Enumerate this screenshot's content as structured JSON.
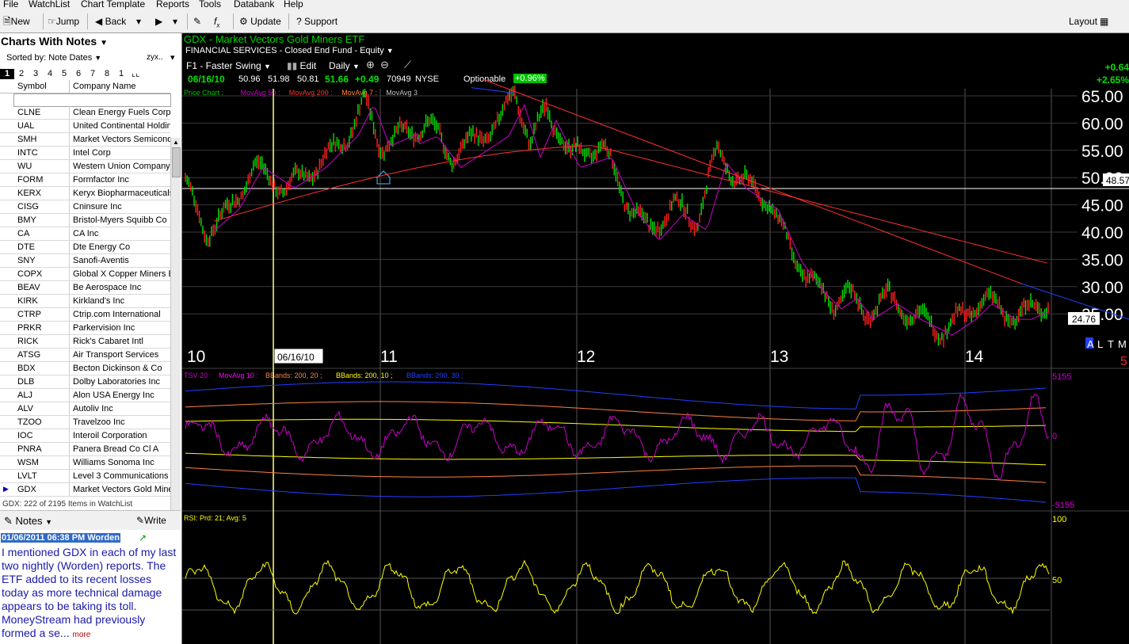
{
  "menu": [
    "File",
    "WatchList",
    "Chart Template",
    "Reports",
    "Tools",
    "Databank",
    "Help"
  ],
  "toolbar": {
    "new": "New",
    "jump": "Jump",
    "back": "Back",
    "update": "Update",
    "support": "Support",
    "layout": "Layout"
  },
  "left_panel": {
    "title": "Charts With Notes",
    "sorted_by": "Sorted by: Note Dates",
    "sort_dir": "zyx..",
    "tabs": [
      "1",
      "2",
      "3",
      "4",
      "5",
      "6",
      "7",
      "8",
      "1"
    ],
    "col_symbol": "Symbol",
    "col_company": "Company Name",
    "rows": [
      {
        "sym": "CLNE",
        "name": "Clean Energy Fuels Corp"
      },
      {
        "sym": "UAL",
        "name": "United Continental Holding"
      },
      {
        "sym": "SMH",
        "name": "Market Vectors Semicond"
      },
      {
        "sym": "INTC",
        "name": "Intel Corp"
      },
      {
        "sym": "WU",
        "name": "Western Union Company"
      },
      {
        "sym": "FORM",
        "name": "Formfactor Inc"
      },
      {
        "sym": "KERX",
        "name": "Keryx Biopharmaceuticals"
      },
      {
        "sym": "CISG",
        "name": "Cninsure Inc"
      },
      {
        "sym": "BMY",
        "name": "Bristol-Myers Squibb Co"
      },
      {
        "sym": "CA",
        "name": "CA Inc"
      },
      {
        "sym": "DTE",
        "name": "Dte Energy Co"
      },
      {
        "sym": "SNY",
        "name": "Sanofi-Aventis"
      },
      {
        "sym": "COPX",
        "name": "Global X Copper Miners Et"
      },
      {
        "sym": "BEAV",
        "name": "Be Aerospace Inc"
      },
      {
        "sym": "KIRK",
        "name": "Kirkland's Inc"
      },
      {
        "sym": "CTRP",
        "name": "Ctrip.com International"
      },
      {
        "sym": "PRKR",
        "name": "Parkervision Inc"
      },
      {
        "sym": "RICK",
        "name": "Rick's Cabaret Intl"
      },
      {
        "sym": "ATSG",
        "name": "Air Transport Services"
      },
      {
        "sym": "BDX",
        "name": "Becton Dickinson & Co"
      },
      {
        "sym": "DLB",
        "name": "Dolby Laboratories Inc"
      },
      {
        "sym": "ALJ",
        "name": "Alon USA Energy Inc"
      },
      {
        "sym": "ALV",
        "name": "Autoliv Inc"
      },
      {
        "sym": "TZOO",
        "name": "Travelzoo Inc"
      },
      {
        "sym": "IOC",
        "name": "Interoil Corporation"
      },
      {
        "sym": "PNRA",
        "name": "Panera Bread Co Cl A"
      },
      {
        "sym": "WSM",
        "name": "Williams Sonoma Inc"
      },
      {
        "sym": "LVLT",
        "name": "Level 3 Communications"
      },
      {
        "sym": "GDX",
        "name": "Market Vectors Gold Mine"
      }
    ],
    "status": "GDX: 222 of 2195 Items in WatchList",
    "notes_label": "Notes",
    "write_label": "Write",
    "note_header": "01/06/2011 06:38 PM Worden",
    "note_text": "I mentioned GDX in each of my last two nightly (Worden) reports. The ETF added to its recent losses today as more technical damage appears to be taking its toll. MoneyStream had previously formed a se...",
    "note_more": "more"
  },
  "chart": {
    "symbol_title": "GDX - Market Vectors Gold Miners ETF",
    "sector": "FINANCIAL SERVICES - Closed End Fund - Equity",
    "template": "F1 - Faster Swing",
    "edit": "Edit",
    "period": "Daily",
    "quote": {
      "date": "06/16/10",
      "open": "50.96",
      "high": "51.98",
      "low": "50.81",
      "close": "51.66",
      "change": "+0.49",
      "volume": "70949",
      "exchange": "NYSE"
    },
    "optionable": "Optionable",
    "pct_badge": "+0.96%",
    "right_change": "+0.64",
    "right_pct": "+2.65%",
    "price_legend": [
      {
        "text": "Price Chart :",
        "color": "#00c000"
      },
      {
        "text": "MovAvg 50 :",
        "color": "#cc00cc"
      },
      {
        "text": "MovAvg 200 :",
        "color": "#ff3030"
      },
      {
        "text": "MovAvg 7 :",
        "color": "#ff8040"
      },
      {
        "text": "MovAvg 3",
        "color": "#c0c0c0"
      }
    ],
    "price_ticks": [
      "65.00",
      "60.00",
      "55.00",
      "50.00",
      "45.00",
      "40.00",
      "35.00",
      "30.00",
      "25.00"
    ],
    "price_readout": "48.57",
    "last_price": "24.76",
    "year_labels": [
      "10",
      "11",
      "12",
      "13",
      "14"
    ],
    "cursor_date": "06/16/10",
    "altm": [
      "A",
      "L",
      "T",
      "M"
    ],
    "red_mark": "5",
    "indicator_legend": [
      {
        "text": "TSV 20 :",
        "color": "#cc00cc"
      },
      {
        "text": "MovAvg 10 :",
        "color": "#ff00ff"
      },
      {
        "text": "BBands: 200, 20 ;",
        "color": "#ff8040"
      },
      {
        "text": "BBands: 200, 10 ;",
        "color": "#ffff00"
      },
      {
        "text": "BBands: 200, 30 ;",
        "color": "#2040ff"
      }
    ],
    "tsv_top": "5155",
    "tsv_zero": "0",
    "tsv_bottom": "-5155",
    "rsi_legend": "RSI: Prd: 21; Avg: 5",
    "rsi_top": "100",
    "rsi_mid": "50",
    "colors": {
      "up": "#00e000",
      "down": "#ff2020",
      "price_bar": "#ffffff",
      "ma50": "#cc00cc",
      "ma200": "#ff3030",
      "trend": "#ff3030",
      "trend_ext": "#2040ff",
      "cursor": "#ffff80",
      "rsi": "#ffff00",
      "tsv": "#cc00cc"
    }
  }
}
